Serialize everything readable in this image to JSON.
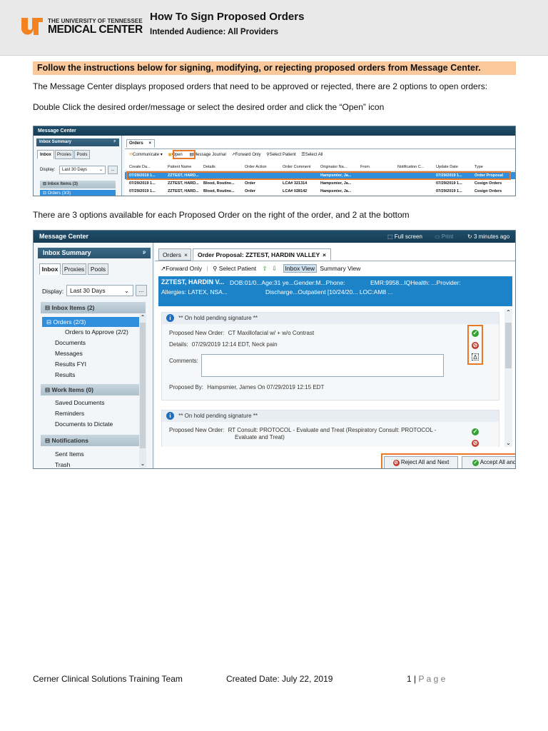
{
  "header": {
    "logo_line1": "THE UNIVERSITY OF TENNESSEE",
    "logo_line2": "MEDICAL CENTER",
    "logo_mark": "UT",
    "title": "How To Sign Proposed Orders",
    "subtitle": "Intended Audience: All Providers"
  },
  "highlight_text": "Follow the instructions below for signing, modifying, or rejecting proposed orders from Message Center.",
  "para1": "The Message Center displays proposed orders that need to be approved or rejected, there are 2 options to open orders:",
  "para2": "Double Click the desired order/message or select the desired order and click the “Open” icon",
  "para3": "There are 3 options available for each Proposed Order on the right of the order, and 2 at the bottom",
  "shot1": {
    "title": "Message Center",
    "inbox_summary": "Inbox Summary",
    "pin": "ᵖ",
    "tabs": [
      "Inbox",
      "Proxies",
      "Pools"
    ],
    "display_label": "Display:",
    "display_value": "Last 30 Days",
    "ellipsis": "...",
    "inbox_items": "Inbox Items (3)",
    "orders": "Orders (3/3)",
    "orders_tab": "Orders",
    "close": "×",
    "toolbar": [
      "Communicate ▾",
      "Open",
      "Message Journal",
      "Forward Only",
      "Select Patient",
      "Select All"
    ],
    "columns": [
      "Create Da...",
      "Patient Name",
      "Details",
      "Order Action",
      "Order Comment",
      "Originator Na...",
      "From",
      "Notification C...",
      "Update Date",
      "Type"
    ],
    "rows": [
      [
        "07/29/2019 1...",
        "ZZTEST, HARD...",
        "",
        "",
        "",
        "Hampsmier, Ja...",
        "",
        "",
        "07/29/2019 1...",
        "Order Proposal"
      ],
      [
        "07/29/2019 1...",
        "ZZTEST, HARD...",
        "Blood, Routine...",
        "Order",
        "LCA# 321314",
        "Hampsmier, Ja...",
        "",
        "",
        "07/29/2019 1...",
        "Cosign Orders"
      ],
      [
        "07/29/2019 1...",
        "ZZTEST, HARD...",
        "Blood, Routine...",
        "Order",
        "LCA# 028142",
        "Hampsmier, Ja...",
        "",
        "",
        "07/29/2019 1...",
        "Cosign Orders"
      ]
    ]
  },
  "shot2": {
    "title": "Message Center",
    "full_screen": "Full screen",
    "print": "Print",
    "refresh": "3 minutes ago",
    "inbox_summary": "Inbox Summary",
    "pin": "ᵖ",
    "tabs": [
      "Inbox",
      "Proxies",
      "Pools"
    ],
    "display_label": "Display:",
    "display_value": "Last 30 Days",
    "ellipsis": "...",
    "inbox_items": "Inbox Items (2)",
    "orders": "Orders (2/3)",
    "orders_to_approve": "Orders to Approve (2/2)",
    "items1": [
      "Documents",
      "Messages",
      "Results FYI",
      "Results"
    ],
    "work_items": "Work Items (0)",
    "items2": [
      "Saved Documents",
      "Reminders",
      "Documents to Dictate"
    ],
    "notifications": "Notifications",
    "items3": [
      "Sent Items",
      "Trash"
    ],
    "doc_tabs": [
      "Orders",
      "Order Proposal: ZZTEST, HARDIN VALLEY"
    ],
    "close": "×",
    "toolbar": [
      "Forward Only",
      "Select Patient",
      "Inbox View",
      "Summary View"
    ],
    "banner_line1": "ZZTEST, HARDIN V...",
    "banner_line1b": "DOB:01/0...Age:31 ye...Gender:M...Phone:",
    "banner_line1c": "EMR:9958...IQHealth: ...Provider:",
    "banner_line2": "Allergies: LATEX, NSA...",
    "banner_line2b": "Discharge...Outpatient [10/24/20... LOC:AM8 ...",
    "card1": {
      "status": "** On hold pending signature **",
      "proposed_label": "Proposed New Order:",
      "proposed_value": "CT Maxillofacial w/ + w/o Contrast",
      "details_label": "Details:",
      "details_value": "07/29/2019 12:14 EDT, Neck pain",
      "comments_label": "Comments:",
      "proposed_by_label": "Proposed By:",
      "proposed_by_value": "Hampsmier, James On 07/29/2019 12:15 EDT"
    },
    "card2": {
      "status": "** On hold pending signature **",
      "proposed_label": "Proposed New Order:",
      "proposed_value": "RT Consult: PROTOCOL - Evaluate and Treat (Respiratory Consult: PROTOCOL -",
      "proposed_value2": "Evaluate and Treat)"
    },
    "icons": {
      "accept": "✓",
      "reject": "⊘",
      "modify": "Δ"
    },
    "reject_all": "Reject All and Next",
    "accept_all": "Accept All and Next"
  },
  "footer": {
    "left": "Cerner Clinical Solutions Training Team",
    "center": "Created Date: July 22, 2019",
    "page_num": "1",
    "page_sep": " | ",
    "page_word": "P a g e"
  },
  "colors": {
    "highlight": "#fac89b",
    "accent_orange": "#e8792a",
    "selection_blue": "#2f8fdc",
    "header_gray": "#e9e9e9"
  }
}
